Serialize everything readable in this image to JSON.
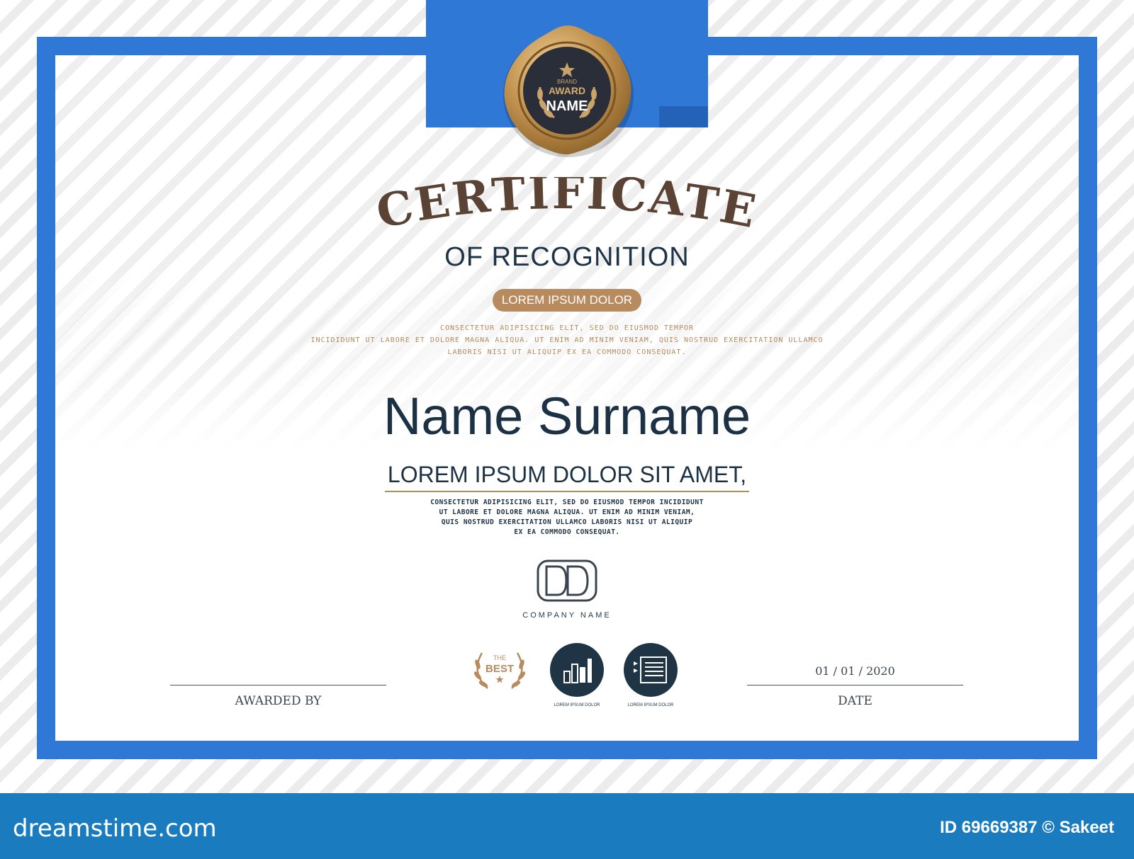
{
  "seal": {
    "top_text": "BRAND",
    "middle_text": "AWARD",
    "bottom_text": "NAME"
  },
  "title": "CERTIFICATE",
  "subtitle": "OF RECOGNITION",
  "pill_label": "LOREM IPSUM DOLOR",
  "gold_text": [
    "CONSECTETUR ADIPISICING ELIT, SED DO EIUSMOD TEMPOR",
    "INCIDIDUNT UT LABORE ET DOLORE MAGNA ALIQUA. UT ENIM  AD MINIM VENIAM, QUIS NOSTRUD EXERCITATION ULLAMCO",
    "LABORIS NISI UT ALIQUIP EX EA COMMODO CONSEQUAT."
  ],
  "recipient_name": "Name Surname",
  "tagline": "LOREM IPSUM DOLOR SIT AMET,",
  "body_text": [
    "CONSECTETUR ADIPISICING ELIT, SED DO EIUSMOD TEMPOR INCIDIDUNT",
    "UT LABORE ET DOLORE MAGNA ALIQUA. UT ENIM AD MINIM VENIAM,",
    "QUIS NOSTRUD EXERCITATION ULLAMCO LABORIS NISI UT ALIQUIP",
    "EX EA COMMODO CONSEQUAT."
  ],
  "company_name": "COMPANY NAME",
  "signature": {
    "awarded_by_label": "AWARDED BY",
    "date_label": "DATE",
    "date_value": "01 / 01 / 2020"
  },
  "badges": {
    "best_top": "THE",
    "best_main": "BEST",
    "icon1_label": "LOREM IPSUM DOLOR",
    "icon2_label": "LOREM IPSUM DOLOR"
  },
  "footer": {
    "brand": "dreamstime.com",
    "credit": "ID 69669387 © Sakeet"
  },
  "colors": {
    "frame_blue": "#2f78d6",
    "gold": "#b88b5e",
    "title_brown": "#5a4334",
    "navy": "#1d3144",
    "footer_blue": "#1a7cbf"
  }
}
